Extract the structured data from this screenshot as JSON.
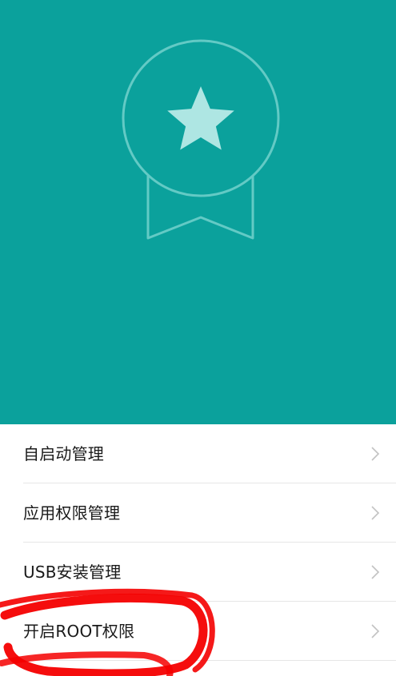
{
  "colors": {
    "hero_background": "#0ba19c",
    "badge_stroke": "#63cac5",
    "star_fill": "#aee6e3",
    "list_text": "#1a1a1a",
    "chevron": "#c2c2c2",
    "annotation_marker": "#f40000"
  },
  "hero": {
    "badge_icon": "award-ribbon-icon",
    "star_icon": "star-icon"
  },
  "menu": {
    "items": [
      {
        "label": "自启动管理",
        "icon": "chevron-right-icon"
      },
      {
        "label": "应用权限管理",
        "icon": "chevron-right-icon"
      },
      {
        "label": "USB安装管理",
        "icon": "chevron-right-icon"
      },
      {
        "label": "开启ROOT权限",
        "icon": "chevron-right-icon"
      }
    ]
  },
  "annotation": {
    "type": "hand-drawn-circle",
    "target": "开启ROOT权限"
  }
}
